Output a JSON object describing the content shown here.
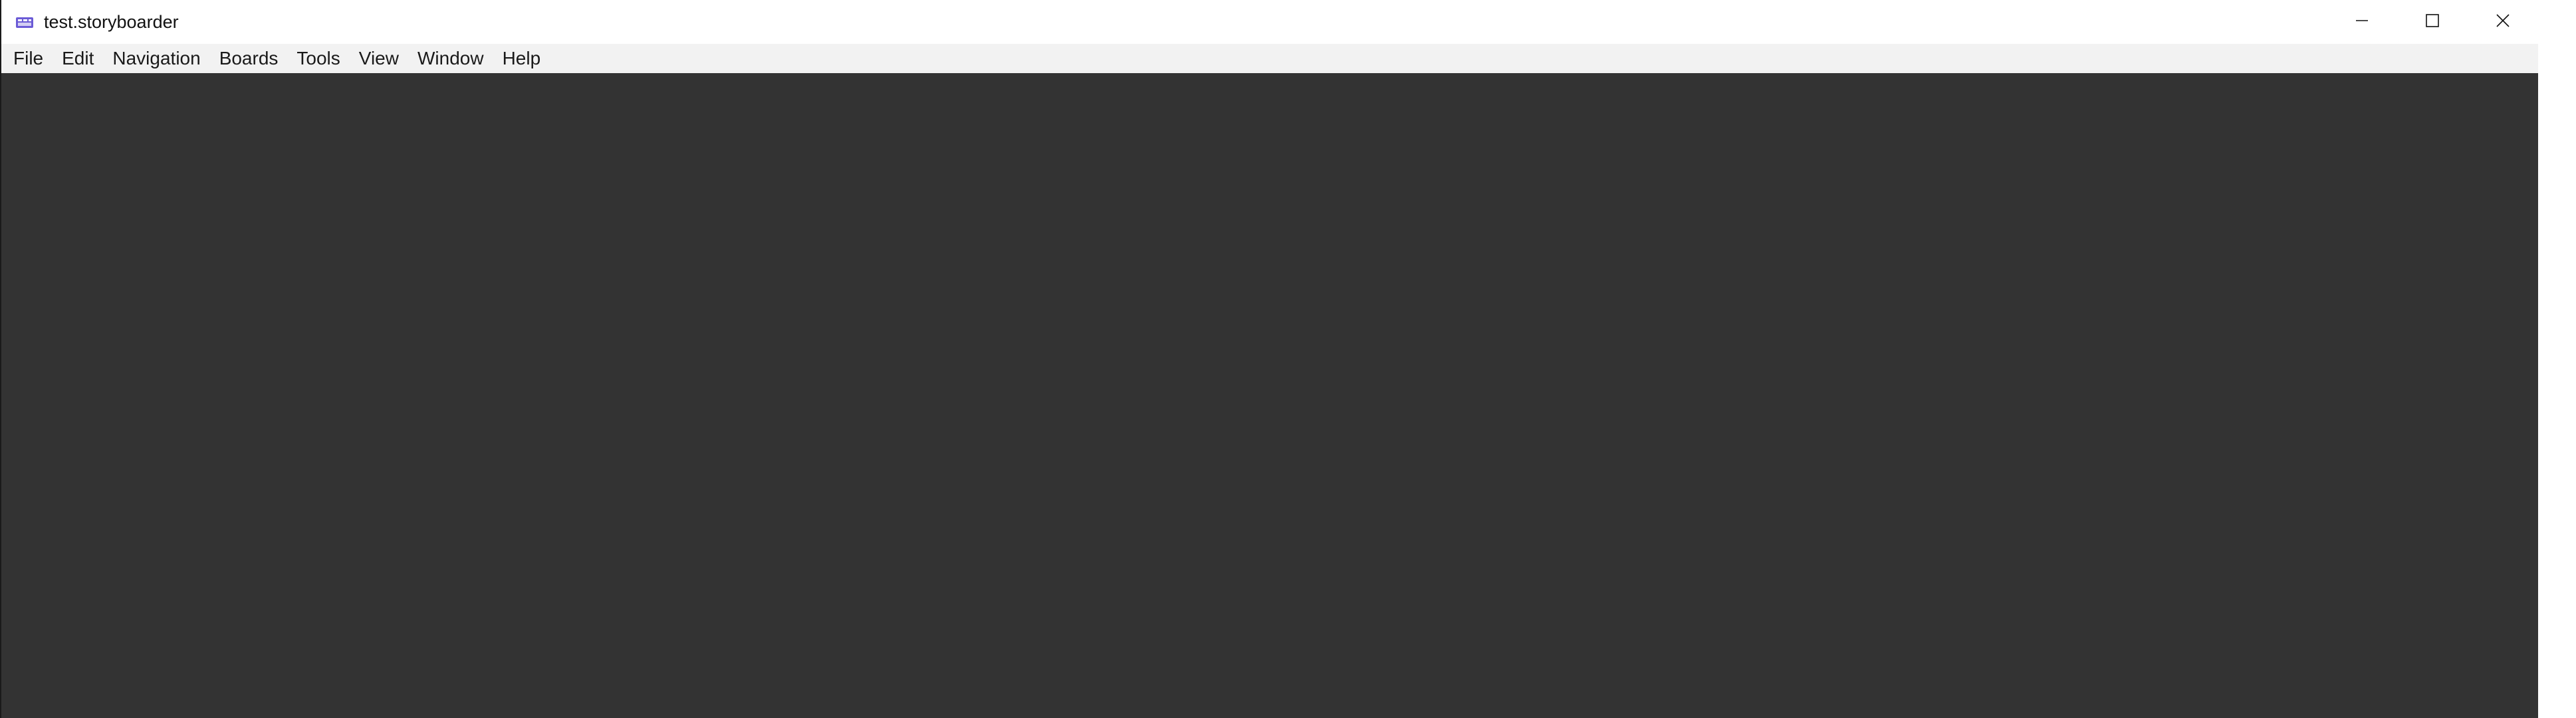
{
  "window": {
    "title": "test.storyboarder",
    "app_icon": "storyboarder-app-icon",
    "controls": {
      "minimize_icon": "minimize-icon",
      "maximize_icon": "maximize-icon",
      "close_icon": "close-icon"
    }
  },
  "menubar": {
    "items": [
      "File",
      "Edit",
      "Navigation",
      "Boards",
      "Tools",
      "View",
      "Window",
      "Help"
    ]
  },
  "colors": {
    "titlebar": "#ffffff",
    "menubar": "#f2f2f2",
    "canvas": "#333333",
    "app_icon_accent": "#6b5bd6"
  }
}
